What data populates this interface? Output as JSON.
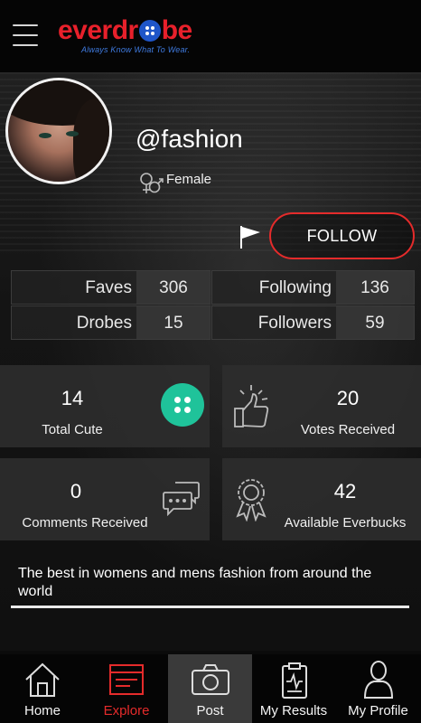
{
  "header": {
    "brand_before": "everdr",
    "brand_after": "be",
    "tagline": "Always Know What To Wear."
  },
  "profile": {
    "username": "@fashion",
    "gender": "Female",
    "follow_label": "FOLLOW"
  },
  "stats": {
    "faves_label": "Faves",
    "faves": "306",
    "following_label": "Following",
    "following": "136",
    "drobes_label": "Drobes",
    "drobes": "15",
    "followers_label": "Followers",
    "followers": "59"
  },
  "cards": {
    "cute_count": "14",
    "cute_label": "Total Cute",
    "votes_count": "20",
    "votes_label": "Votes Received",
    "comments_count": "0",
    "comments_label": "Comments Received",
    "everbucks_count": "42",
    "everbucks_label": "Available Everbucks"
  },
  "bio": "The best in womens and mens fashion from around the world",
  "nav": {
    "home": "Home",
    "explore": "Explore",
    "post": "Post",
    "results": "My Results",
    "profile": "My Profile"
  },
  "colors": {
    "accent_red": "#e52b2b",
    "cute_green": "#1fc39a",
    "brand_blue": "#1f56c9"
  },
  "icons": [
    "menu-icon",
    "flag-icon",
    "gender-icon",
    "button-icon",
    "thumbs-up-icon",
    "comment-icon",
    "badge-icon",
    "home-icon",
    "explore-icon",
    "camera-icon",
    "clipboard-icon",
    "person-icon"
  ]
}
